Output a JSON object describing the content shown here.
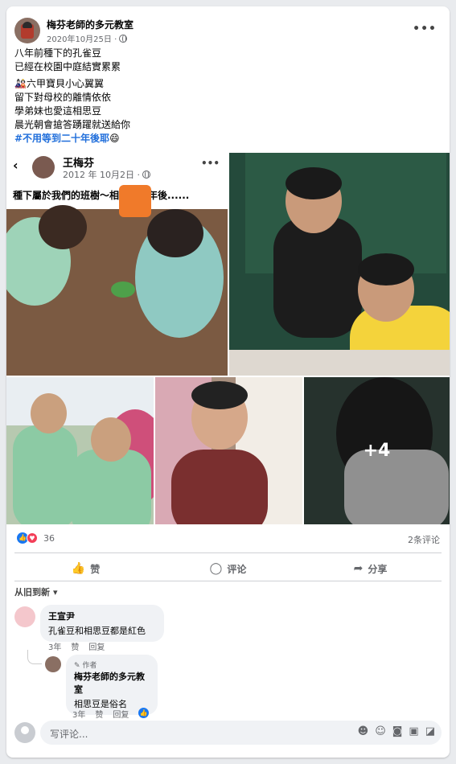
{
  "post": {
    "page_name": "梅芬老師的多元教室",
    "date": "2020年10月25日 ·",
    "lines": [
      "八年前種下的孔雀豆",
      "已經在校園中庭結實累累"
    ],
    "lines2": [
      "🎎六甲寶貝小心翼翼",
      "留下對母校的離情依依",
      "學弟妹也愛這相思豆",
      "晨光朝會搶答踴躍就送給你"
    ],
    "hashtag": "#不用等到二十年後耶",
    "emoji": "😄",
    "more_label": "•••"
  },
  "shared": {
    "back": "‹",
    "name": "王梅芬",
    "date": "2012 年 10月2日 ·",
    "caption": "種下屬於我們的班樹～相約二十年後......",
    "more": "•••"
  },
  "photos": {
    "more_count": "+4"
  },
  "reactions": {
    "count": "36",
    "comments": "2条评论"
  },
  "actions": {
    "like": "赞",
    "comment": "评论",
    "share": "分享"
  },
  "sort_label": "从旧到新",
  "comments": [
    {
      "name": "王宣尹",
      "text": "孔雀豆和相思豆都是紅色",
      "time": "3年",
      "like": "赞",
      "reply": "回复"
    }
  ],
  "reply": {
    "tag": "作者",
    "name": "梅芬老師的多元教室",
    "text": "相思豆是俗名",
    "time": "3年",
    "like": "赞",
    "reply": "回复"
  },
  "write": {
    "placeholder": "写评论..."
  },
  "colors": {
    "accent": "#1877f2",
    "love": "#f33e58",
    "hashtag": "#216fdb"
  }
}
